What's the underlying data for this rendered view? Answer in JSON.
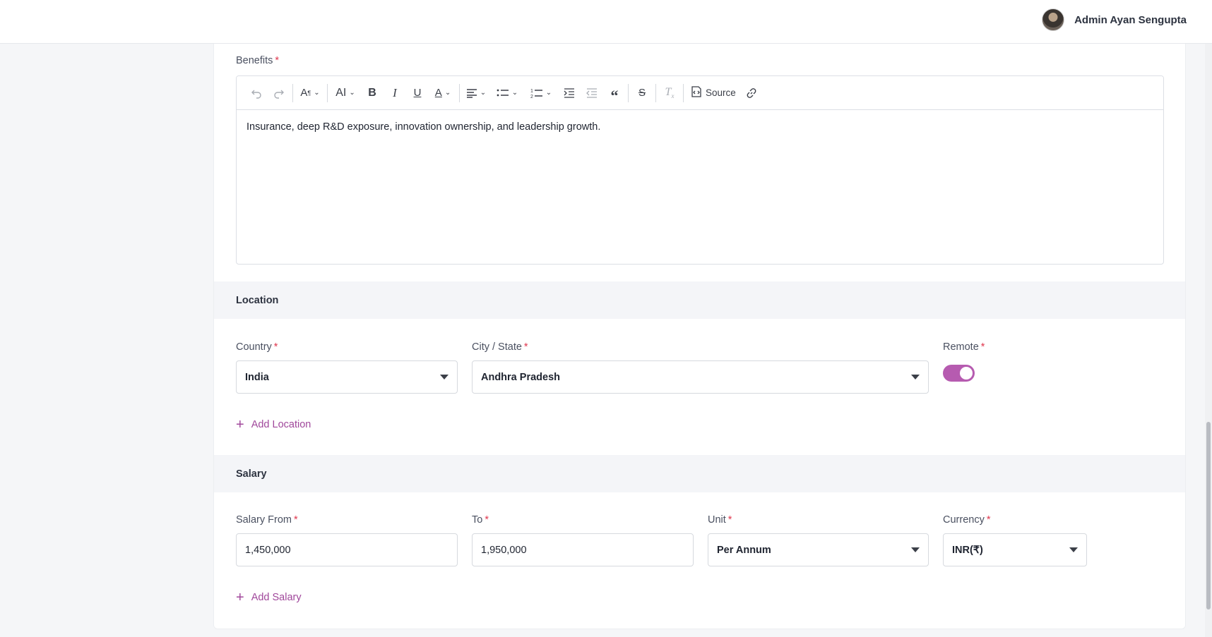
{
  "header": {
    "user_name": "Admin Ayan Sengupta"
  },
  "benefits": {
    "label": "Benefits",
    "required_mark": "*",
    "toolbar": {
      "source_label": "Source",
      "icons": [
        "undo-icon",
        "redo-icon",
        "font-family-icon",
        "font-size-icon",
        "bold-icon",
        "italic-icon",
        "underline-icon",
        "font-color-icon",
        "align-icon",
        "bulleted-list-icon",
        "numbered-list-icon",
        "indent-icon",
        "outdent-icon",
        "block-quote-icon",
        "strikethrough-icon",
        "remove-format-icon",
        "source-icon",
        "link-icon"
      ]
    },
    "content": "Insurance, deep R&D exposure, innovation ownership, and leadership growth."
  },
  "location": {
    "title": "Location",
    "country": {
      "label": "Country",
      "value": "India"
    },
    "city_state": {
      "label": "City / State",
      "value": "Andhra Pradesh"
    },
    "remote": {
      "label": "Remote",
      "on": true
    },
    "add_label": "Add Location"
  },
  "salary": {
    "title": "Salary",
    "from": {
      "label": "Salary From",
      "value": "1,450,000"
    },
    "to": {
      "label": "To",
      "value": "1,950,000"
    },
    "unit": {
      "label": "Unit",
      "value": "Per Annum"
    },
    "currency": {
      "label": "Currency",
      "value": "INR(₹)"
    },
    "add_label": "Add Salary"
  },
  "colors": {
    "accent": "#b65bb0",
    "link": "#a0479b",
    "required": "#e0384f"
  }
}
